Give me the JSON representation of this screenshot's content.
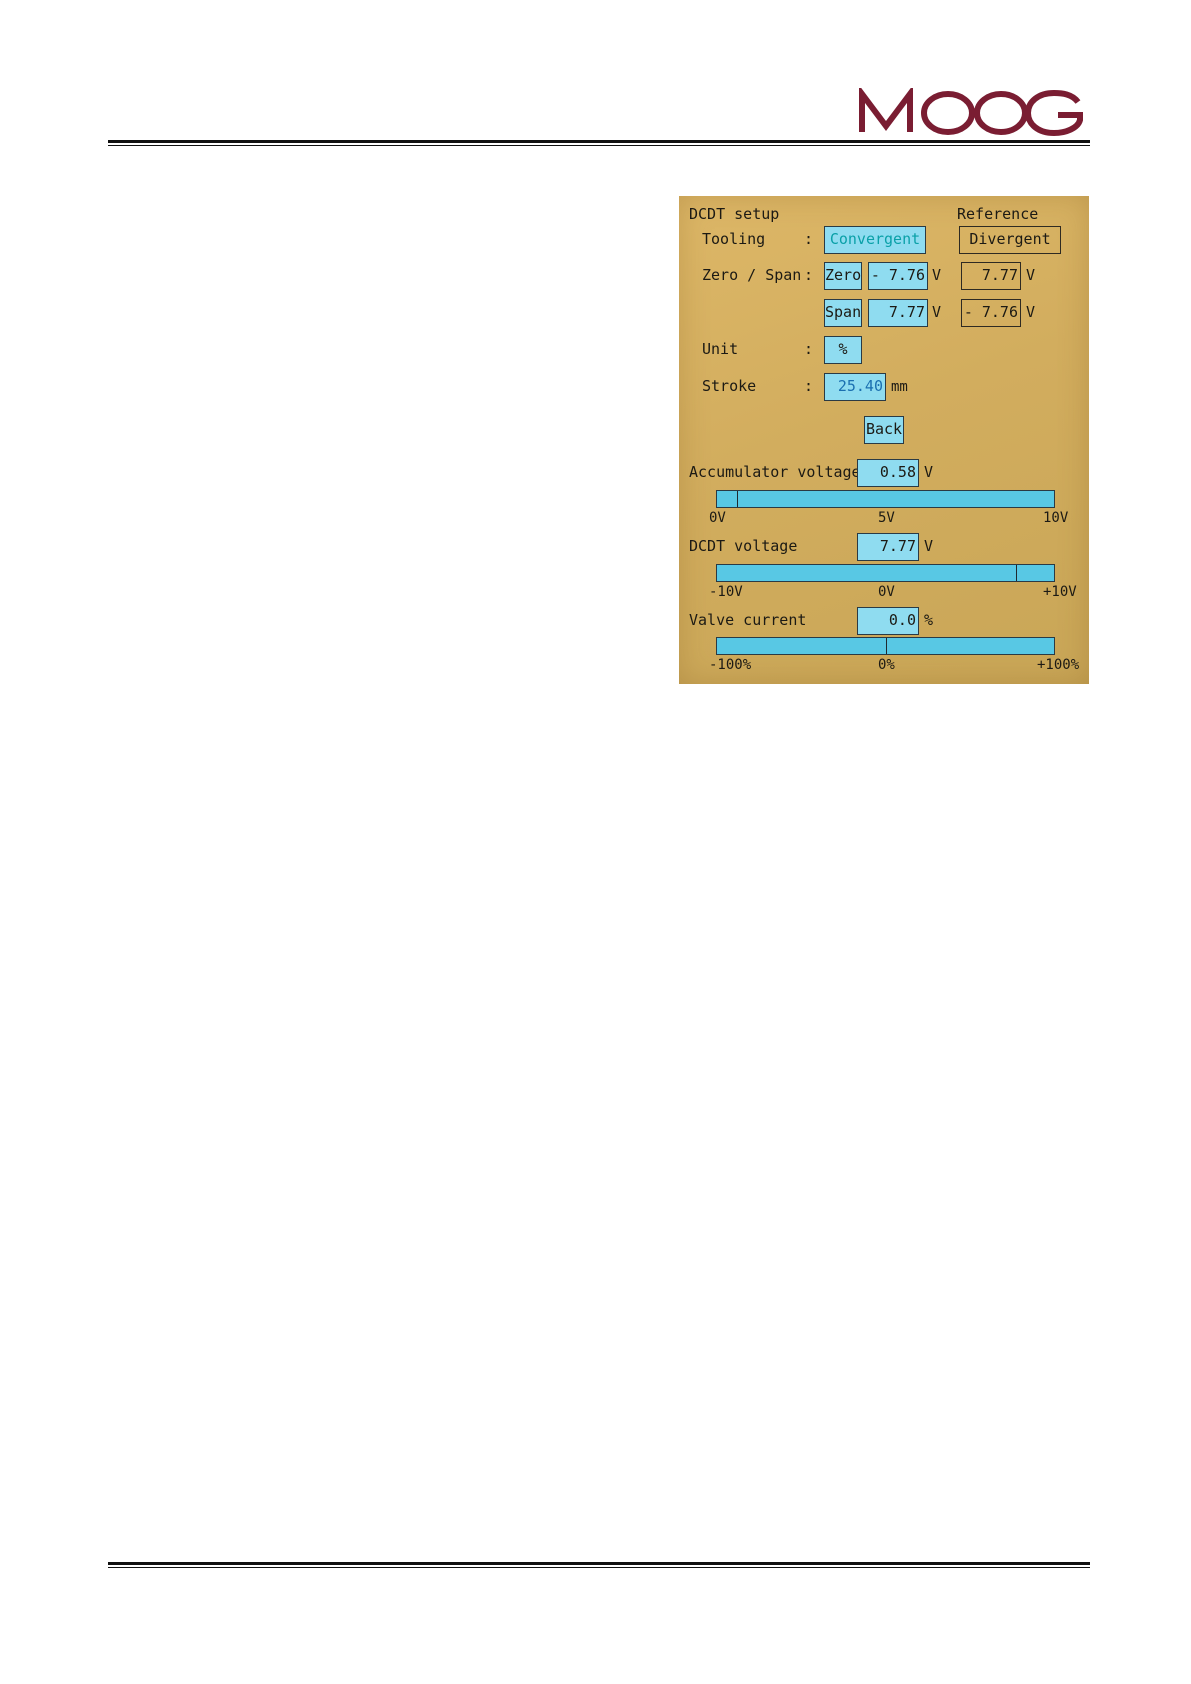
{
  "brand": {
    "name": "MOOG",
    "color": "#7a1d32"
  },
  "screen": {
    "title": "DCDT setup",
    "reference_label": "Reference",
    "tooling": {
      "label": "Tooling",
      "colon": ":",
      "value": "Convergent",
      "reference": "Divergent"
    },
    "zero_span": {
      "label": "Zero / Span",
      "colon": ":",
      "zero_button": "Zero",
      "zero_value": "- 7.76",
      "zero_unit": "V",
      "zero_reference": "7.77",
      "zero_reference_unit": "V",
      "span_button": "Span",
      "span_value": "7.77",
      "span_unit": "V",
      "span_reference": "- 7.76",
      "span_reference_unit": "V"
    },
    "unit": {
      "label": "Unit",
      "colon": ":",
      "value": "%"
    },
    "stroke": {
      "label": "Stroke",
      "colon": ":",
      "value": "25.40",
      "unit": "mm"
    },
    "back_button": "Back",
    "accumulator": {
      "label": "Accumulator voltage",
      "value": "0.58",
      "unit": "V",
      "level": 0.058,
      "ticks": [
        "0V",
        "5V",
        "10V"
      ]
    },
    "dcdt": {
      "label": "DCDT voltage",
      "value": "7.77",
      "unit": "V",
      "level": 0.8885,
      "ticks": [
        "-10V",
        "0V",
        "+10V"
      ]
    },
    "valve": {
      "label": "Valve current",
      "value": "0.0",
      "unit": "%",
      "level": 0.5,
      "ticks": [
        "-100%",
        "0%",
        "+100%"
      ]
    }
  }
}
